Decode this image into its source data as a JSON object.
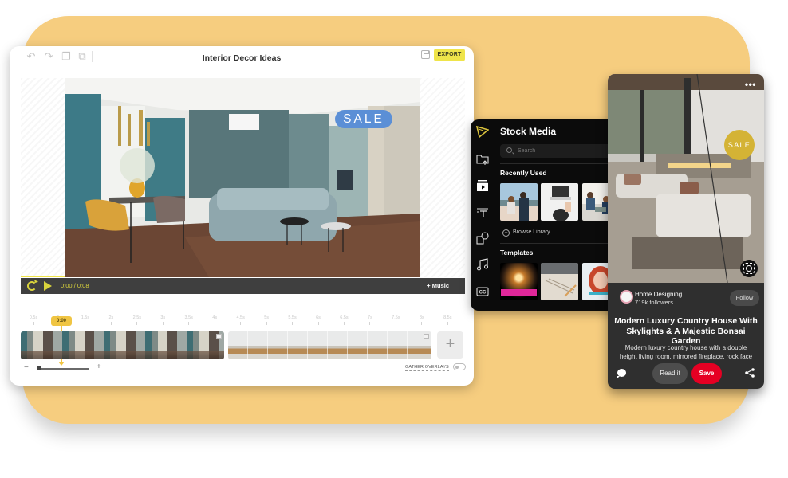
{
  "colors": {
    "backdrop": "#f6cd7f",
    "accent_yellow": "#efe44a",
    "playhead": "#f0c543",
    "sale_blue": "#5b8fd6",
    "sale_gold": "#d4b335",
    "pin_save_red": "#e60023",
    "stock_bg": "#0b0b0b"
  },
  "editor": {
    "title": "Interior Decor Ideas",
    "toolbar": {
      "undo_icon": "undo-icon",
      "redo_icon": "redo-icon",
      "duplicate_icon": "duplicate-icon",
      "group_icon": "group-icon",
      "save_icon": "save-icon",
      "export_label": "EXPORT"
    },
    "canvas": {
      "overlay_text": "SALE"
    },
    "player": {
      "current_time": "0:00",
      "separator": "/",
      "duration": "0:08",
      "music_label": "+ Music",
      "progress_fraction": 0.0
    },
    "timeline": {
      "playhead_label": "0:00",
      "ticks": [
        "0.5s",
        "1s",
        "1.5s",
        "2s",
        "2.5s",
        "3s",
        "3.5s",
        "4s",
        "4.5s",
        "5s",
        "5.5s",
        "6s",
        "6.5s",
        "7s",
        "7.5s",
        "8s",
        "8.5s"
      ],
      "clips": [
        {
          "name": "Living room scene"
        },
        {
          "name": "Sideboard scene"
        }
      ],
      "add_clip_label": "+",
      "zoom_minus": "−",
      "zoom_plus": "+",
      "zoom_level_fraction": 0.0,
      "gather_overlays_label": "GATHER OVERLAYS",
      "gather_overlays_on": false
    }
  },
  "stock_media": {
    "title": "Stock Media",
    "search_placeholder": "Search",
    "rail_icons": [
      "logo-icon",
      "upload-folder-icon",
      "video-library-icon",
      "text-icon",
      "shapes-icon",
      "music-icon",
      "captions-icon"
    ],
    "recently_used": {
      "label": "Recently Used",
      "items": [
        "Couple walking outdoors",
        "Laptop on desk",
        "Office high-five"
      ]
    },
    "browse_label": "Browse Library",
    "templates": {
      "label": "Templates",
      "items": [
        "Fireworks template",
        "Notebook template",
        "Speaker template"
      ]
    }
  },
  "pin": {
    "menu_label": "•••",
    "sale_badge": "SALE",
    "author": "Home Designing",
    "followers": "719k followers",
    "follow_label": "Follow",
    "title": "Modern Luxury Country House With Skylights & A Majestic Bonsai Garden",
    "description": "Modern luxury country house with a double height living room, mirrored fireplace, rock face",
    "read_label": "Read it",
    "save_label": "Save"
  }
}
